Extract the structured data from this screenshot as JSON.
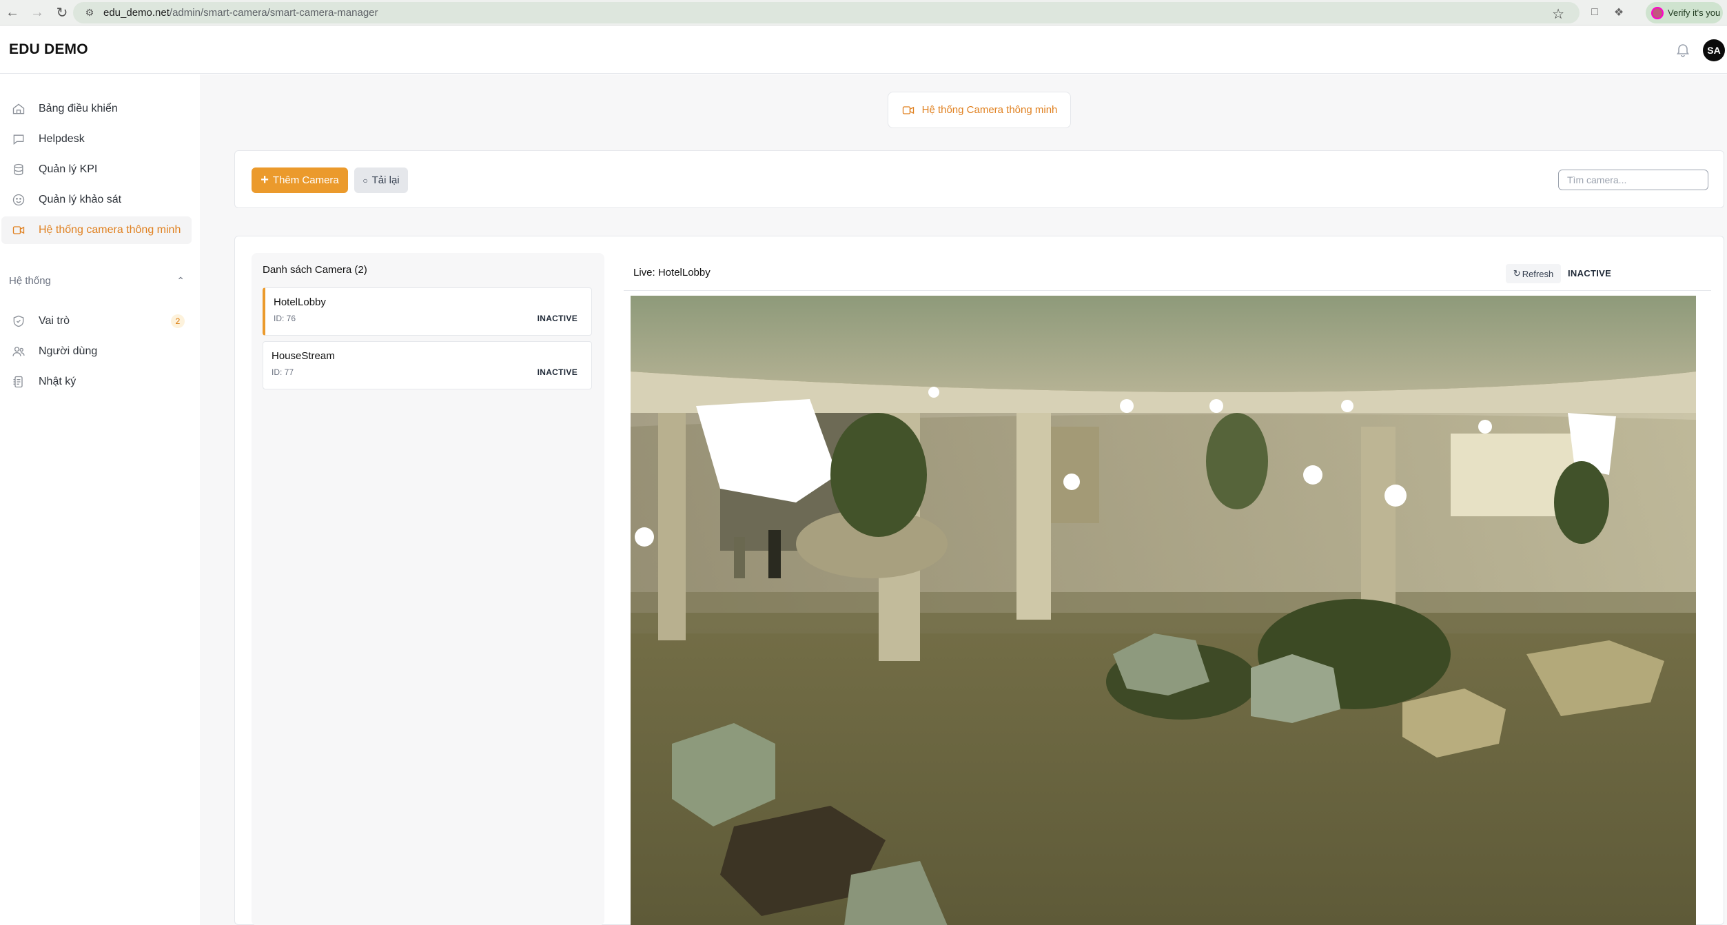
{
  "browser": {
    "url_host": "edu_demo.net",
    "url_path": "/admin/smart-camera/smart-camera-manager",
    "verify_label": "Verify it's you"
  },
  "header": {
    "brand": "EDU DEMO",
    "avatar_initials": "SA"
  },
  "sidebar": {
    "items": [
      {
        "label": "Bảng điều khiển",
        "icon": "home-icon"
      },
      {
        "label": "Helpdesk",
        "icon": "chat-icon"
      },
      {
        "label": "Quản lý KPI",
        "icon": "database-icon"
      },
      {
        "label": "Quản lý khảo sát",
        "icon": "smile-icon"
      },
      {
        "label": "Hệ thống camera thông minh",
        "icon": "video-camera-icon",
        "active": true
      }
    ],
    "group_label": "Hệ thống",
    "system_items": [
      {
        "label": "Vai trò",
        "icon": "shield-icon",
        "badge": "2"
      },
      {
        "label": "Người dùng",
        "icon": "users-icon"
      },
      {
        "label": "Nhật ký",
        "icon": "log-icon"
      }
    ]
  },
  "page": {
    "title": "Hệ thống Camera thông minh",
    "add_button": "Thêm Camera",
    "reload_button": "Tải lại",
    "search_placeholder": "Tìm camera..."
  },
  "camera_list": {
    "title": "Danh sách Camera (2)",
    "cameras": [
      {
        "name": "HotelLobby",
        "id": "ID: 76",
        "status": "INACTIVE",
        "selected": true
      },
      {
        "name": "HouseStream",
        "id": "ID: 77",
        "status": "INACTIVE",
        "selected": false
      }
    ]
  },
  "live": {
    "title": "Live: HotelLobby",
    "refresh_label": "Refresh",
    "status": "INACTIVE"
  },
  "colors": {
    "accent": "#e0801f",
    "accent_button": "#eb9a2c"
  }
}
